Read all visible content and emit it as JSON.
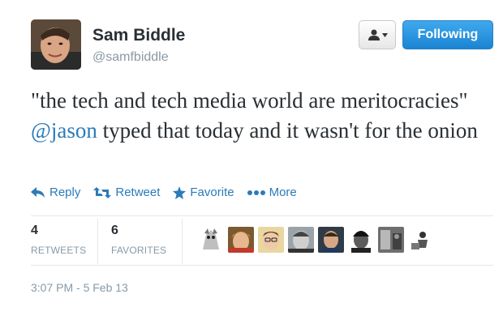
{
  "tweet": {
    "author": {
      "name": "Sam Biddle",
      "handle": "@samfbiddle"
    },
    "text": {
      "part1": "\"the tech and tech media world are meritocracies\"",
      "mention": "@jason",
      "part2": "typed that today and it wasn't for the onion"
    },
    "timestamp": "3:07 PM - 5 Feb 13"
  },
  "header": {
    "follow_label": "Following",
    "user_dropdown_icon": "person-dropdown-icon",
    "colors": {
      "follow_button": "#2b8fe0"
    }
  },
  "actions": [
    {
      "label": "Reply",
      "icon": "reply-icon"
    },
    {
      "label": "Retweet",
      "icon": "retweet-icon"
    },
    {
      "label": "Favorite",
      "icon": "star-icon"
    },
    {
      "label": "More",
      "icon": "more-dots-icon"
    }
  ],
  "stats": {
    "retweets": {
      "count": "4",
      "label": "RETWEETS"
    },
    "favorites": {
      "count": "6",
      "label": "FAVORITES"
    }
  },
  "colors": {
    "link": "#2b7bb9",
    "muted": "#8899a6",
    "text": "#292f33"
  }
}
